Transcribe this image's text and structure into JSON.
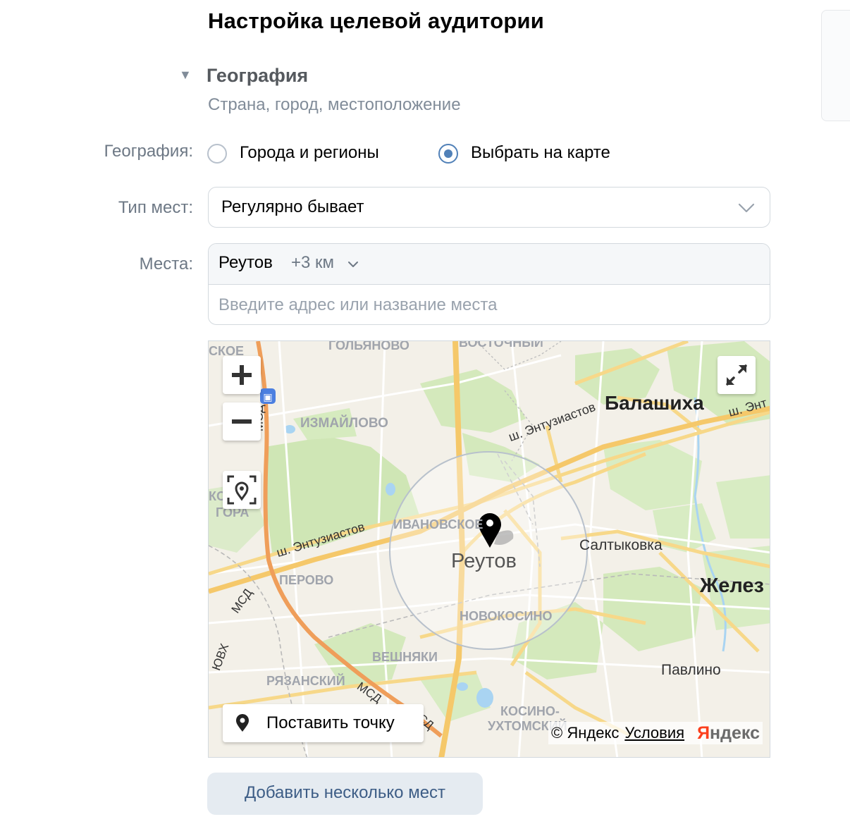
{
  "page": {
    "title": "Настройка целевой аудитории"
  },
  "section": {
    "title": "География",
    "subtitle": "Страна, город, местоположение"
  },
  "geography": {
    "label": "География:",
    "options": [
      {
        "label": "Города и регионы",
        "selected": false
      },
      {
        "label": "Выбрать на карте",
        "selected": true
      }
    ]
  },
  "place_type": {
    "label": "Тип мест:",
    "value": "Регулярно бывает"
  },
  "places": {
    "label": "Места:",
    "selected_place": "Реутов",
    "radius": "+3 км",
    "input_placeholder": "Введите адрес или название места"
  },
  "map": {
    "put_point_label": "Поставить точку",
    "attribution": "© Яндекс",
    "terms_link": "Условия",
    "logo_first": "Я",
    "logo_rest": "ндекс",
    "center_city": "Реутов",
    "labels": {
      "skoe": "СКОЕ",
      "golyanovo": "ГОЛЬЯНОВО",
      "vostochny": "ВОСТОЧНЫЙ",
      "balashikha": "Балашиха",
      "sh_ent_top": "ш. Энт",
      "izmailovo": "ИЗМАЙЛОВО",
      "sh_entuziastov_ne": "ш. Энтузиастов",
      "msd_1": "МСД",
      "kosaya_gora_1": "КОСАЯ",
      "kosaya_gora_2": "ГОРА",
      "ivanovskoe": "ИВАНОВСКОЕ",
      "sh_entuziastov_w": "ш. Энтузиастов",
      "saltykovka": "Салтыковка",
      "perovo": "ПЕРОВО",
      "zhelez": "Желез",
      "msd_2": "МСД",
      "novokosino": "НОВОКОСИНО",
      "yuvkh": "ЮВХ",
      "veshnyaki": "ВЕШНЯКИ",
      "ryazansky": "РЯЗАНСКИЙ",
      "msd_3": "МСД",
      "pavlino": "Павлино",
      "kosino_1": "КОСИНО-",
      "kosino_2": "УХТОМСКИЙ",
      "msd_4": "СД"
    }
  },
  "add_button": {
    "label": "Добавить несколько мест"
  },
  "colors": {
    "accent": "#5181b8",
    "button_bg": "#e5ebf1",
    "button_text": "#3d5d86",
    "muted_text": "#818c99"
  }
}
